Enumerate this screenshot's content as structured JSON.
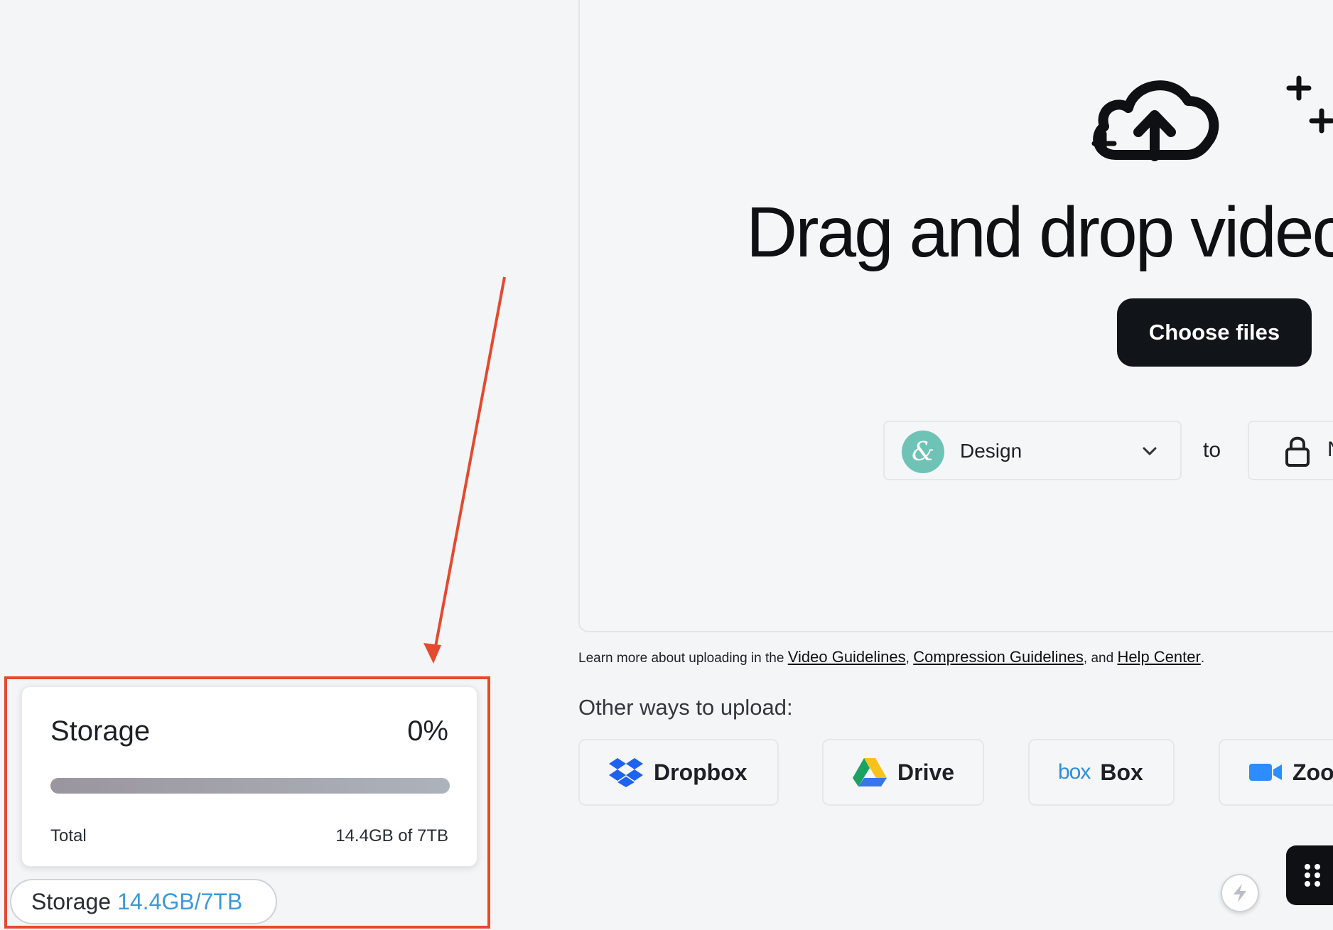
{
  "upload": {
    "headline": "Drag and drop videc",
    "choose_button": "Choose files",
    "project": {
      "avatar": "&",
      "label": "Design"
    },
    "to_label": "to",
    "privacy_label": "N",
    "learn_more": {
      "prefix": "Learn more about uploading in the ",
      "link1": "Video Guidelines",
      "sep1": ", ",
      "link2": "Compression Guidelines",
      "sep2": ", and ",
      "link3": "Help Center",
      "suffix": "."
    },
    "other_ways_title": "Other ways to upload:",
    "services": [
      {
        "label": "Dropbox",
        "icon": "dropbox-icon"
      },
      {
        "label": "Drive",
        "icon": "google-drive-icon"
      },
      {
        "label": "Box",
        "icon": "box-icon",
        "logo_text": "box"
      },
      {
        "label": "Zoo",
        "icon": "zoom-icon"
      }
    ]
  },
  "storage_popover": {
    "title": "Storage",
    "percent": "0%",
    "used_fraction": 0,
    "total_label": "Total",
    "total_value": "14.4GB of 7TB"
  },
  "storage_pill": {
    "label": "Storage",
    "value": "14.4GB/7TB"
  },
  "colors": {
    "annotation": "#e34a2e",
    "accent_blue": "#3a9ad9",
    "button_dark": "#111418"
  }
}
